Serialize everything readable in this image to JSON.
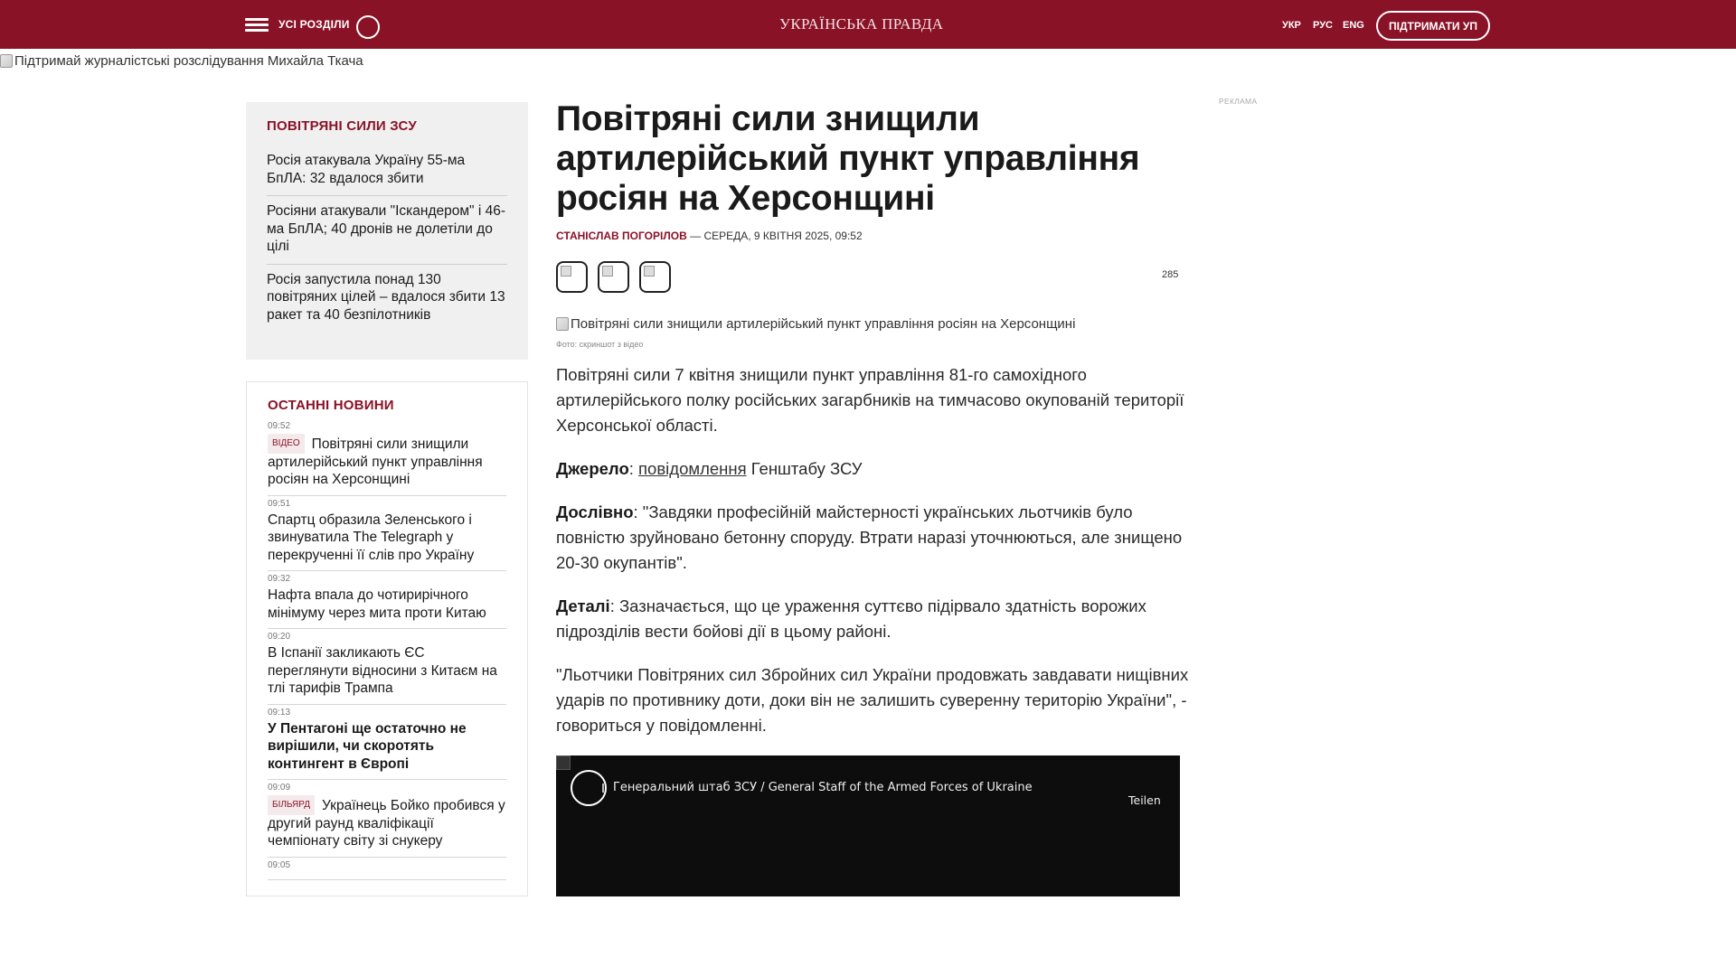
{
  "header": {
    "menu_label": "УСІ РОЗДІЛИ",
    "logo": "УКРАЇНСЬКА ПРАВДА",
    "languages": [
      "УКР",
      "РУС",
      "ENG"
    ],
    "support_button": "ПІДТРИМАТИ УП",
    "colors": {
      "brand": "#8a1227"
    }
  },
  "promo": {
    "alt_text": "Підтримай журналістські розслідування Михайла Ткача"
  },
  "topic_box": {
    "title": "ПОВІТРЯНІ СИЛИ ЗСУ",
    "items": [
      "Росія атакувала Україну 55-ма БпЛА: 32 вдалося збити",
      "Росіяни атакували \"Іскандером\" і 46-ма БпЛА; 40 дронів не долетіли до цілі",
      "Росія запустила понад 130 повітряних цілей – вдалося збити 13 ракет та 40 безпілотників"
    ]
  },
  "latest_news": {
    "title": "ОСТАННІ НОВИНИ",
    "items": [
      {
        "time": "09:52",
        "tag": "ВІДЕО",
        "text": "Повітряні сили знищили артилерійський пункт управління росіян на Херсонщині",
        "bold": false
      },
      {
        "time": "09:51",
        "tag": "",
        "text": "Спартц образила Зеленського і звинуватила The Telegraph у перекрученні її слів про Україну",
        "bold": false
      },
      {
        "time": "09:32",
        "tag": "",
        "text": "Нафта впала до чотирирічного мінімуму через мита проти Китаю",
        "bold": false
      },
      {
        "time": "09:20",
        "tag": "",
        "text": "В Іспанії закликають ЄС переглянути відносини з Китаєм на тлі тарифів Трампа",
        "bold": false
      },
      {
        "time": "09:13",
        "tag": "",
        "text": "У Пентагоні ще остаточно не вирішили, чи скоротять контингент в Європі",
        "bold": true
      },
      {
        "time": "09:09",
        "tag": "БІЛЬЯРД",
        "text": "Українець Бойко пробився у другий раунд кваліфікації чемпіонату світу зі снукеру",
        "bold": false
      },
      {
        "time": "09:05",
        "tag": "",
        "text": "",
        "bold": false
      }
    ]
  },
  "article": {
    "headline": "Повітряні сили знищили артилерійський пункт управління росіян на Херсонщині",
    "author": "СТАНІСЛАВ ПОГОРІЛОВ",
    "byline_separator": " — ",
    "date": "СЕРЕДА, 9 КВІТНЯ 2025, 09:52",
    "share_count": "285",
    "image_alt": "Повітряні сили знищили артилерійський пункт управління росіян на Херсонщині",
    "image_caption": "Фото: скриншот з відео",
    "paragraphs": [
      {
        "label": "",
        "text": "Повітряні сили 7 квітня знищили пункт управління 81-го самохідного артилерійського полку російських загарбників на тимчасово окупованій території Херсонської області."
      },
      {
        "label": "Джерело",
        "link": "повідомлення",
        "text": " Генштабу ЗСУ"
      },
      {
        "label": "Дослівно",
        "text": ": \"Завдяки професійній майстерності українських льотчиків було повністю  зруйновано бетонну споруду. Втрати наразі уточнюються, але знищено 20-30 окупантів\"."
      },
      {
        "label": "Деталі",
        "text": ": Зазначається, що це ураження суттєво підірвало здатність ворожих підрозділів вести бойові дії в цьому районі."
      },
      {
        "label": "",
        "text": "\"Льотчики Повітряних сил Збройних сил України продовжать завдавати нищівних ударів по противнику доти, доки він не залишить суверенну територію України\", - говориться у повідомленні."
      }
    ],
    "source_colon": ": "
  },
  "video": {
    "channel": "Генеральний штаб ЗСУ / General Staff of the Armed Forces of Ukraine",
    "share_label": "Teilen"
  },
  "ad": {
    "label": "РЕКЛАМА"
  }
}
